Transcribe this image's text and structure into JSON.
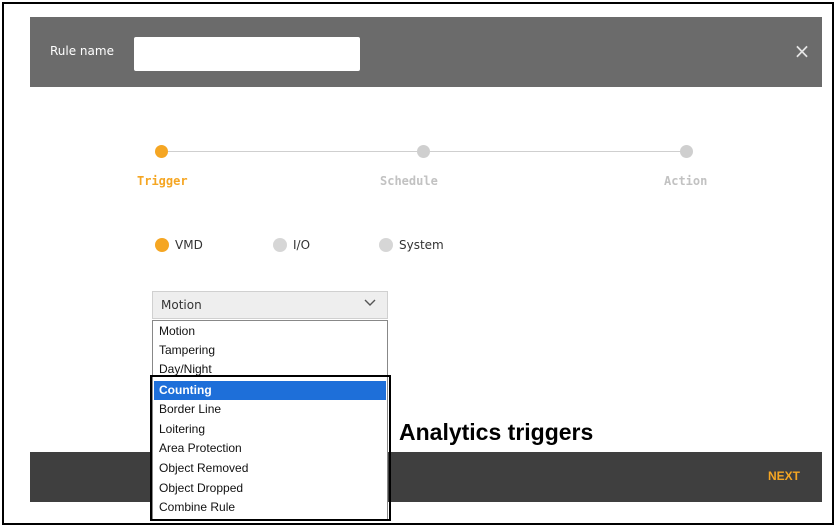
{
  "header": {
    "rule_name_label": "Rule name",
    "rule_name_value": "",
    "close_symbol": "×"
  },
  "steps": [
    {
      "label": "Trigger",
      "state": "active"
    },
    {
      "label": "Schedule",
      "state": "inactive"
    },
    {
      "label": "Action",
      "state": "inactive"
    }
  ],
  "trigger_types": [
    {
      "label": "VMD",
      "selected": true
    },
    {
      "label": "I/O",
      "selected": false
    },
    {
      "label": "System",
      "selected": false
    }
  ],
  "select": {
    "value": "Motion",
    "options": [
      "Motion",
      "Tampering",
      "Day/Night",
      "Counting",
      "Border Line",
      "Loitering",
      "Area Protection",
      "Object Removed",
      "Object Dropped",
      "Combine Rule"
    ],
    "highlighted": "Counting"
  },
  "footer": {
    "next_label": "NEXT"
  },
  "annotation": "Analytics triggers",
  "colors": {
    "accent": "#f5a623",
    "header_bg": "#6b6b6b",
    "footer_bg": "#3f3f3f",
    "highlight": "#1e6fd9"
  }
}
